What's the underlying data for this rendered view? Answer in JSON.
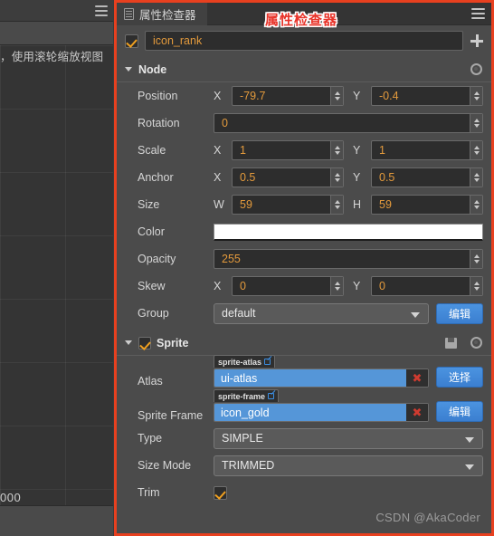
{
  "scene_panel": {
    "hint_text": "，使用滚轮缩放视图",
    "ruler_label": "000",
    "menu_icon": "hamburger-menu-icon"
  },
  "inspector": {
    "tab": {
      "label": "属性检查器",
      "icon": "inspector-list-icon"
    },
    "menu_icon": "hamburger-menu-icon",
    "annotation_text": "属性检查器",
    "annotation_color": "#e8342a",
    "border_color": "#e8401f",
    "node_name": {
      "enabled": true,
      "value": "icon_rank",
      "add_label": "+"
    },
    "sections": [
      {
        "id": "node",
        "title": "Node",
        "expanded": true,
        "has_checkbox": false,
        "properties": [
          {
            "type": "xy",
            "label": "Position",
            "x_axis": "X",
            "x": "-79.7",
            "y_axis": "Y",
            "y": "-0.4"
          },
          {
            "type": "single",
            "label": "Rotation",
            "value": "0"
          },
          {
            "type": "xy",
            "label": "Scale",
            "x_axis": "X",
            "x": "1",
            "y_axis": "Y",
            "y": "1"
          },
          {
            "type": "xy",
            "label": "Anchor",
            "x_axis": "X",
            "x": "0.5",
            "y_axis": "Y",
            "y": "0.5"
          },
          {
            "type": "xy",
            "label": "Size",
            "x_axis": "W",
            "x": "59",
            "y_axis": "H",
            "y": "59"
          },
          {
            "type": "color",
            "label": "Color",
            "value": "#ffffff"
          },
          {
            "type": "single",
            "label": "Opacity",
            "value": "255"
          },
          {
            "type": "xy",
            "label": "Skew",
            "x_axis": "X",
            "x": "0",
            "y_axis": "Y",
            "y": "0"
          },
          {
            "type": "select_btn",
            "label": "Group",
            "value": "default",
            "button_label": "编辑"
          }
        ]
      },
      {
        "id": "sprite",
        "title": "Sprite",
        "expanded": true,
        "has_checkbox": true,
        "checked": true,
        "properties": [
          {
            "type": "asset",
            "label": "Atlas",
            "tag": "sprite-atlas",
            "value": "ui-atlas",
            "clear_label": "✖",
            "button_label": "选择"
          },
          {
            "type": "asset",
            "label": "Sprite Frame",
            "tag": "sprite-frame",
            "value": "icon_gold",
            "clear_label": "✖",
            "button_label": "编辑"
          },
          {
            "type": "select",
            "label": "Type",
            "value": "SIMPLE"
          },
          {
            "type": "select",
            "label": "Size Mode",
            "value": "TRIMMED"
          },
          {
            "type": "checkbox",
            "label": "Trim",
            "checked": true
          }
        ]
      }
    ],
    "watermark": "CSDN @AkaCoder"
  }
}
